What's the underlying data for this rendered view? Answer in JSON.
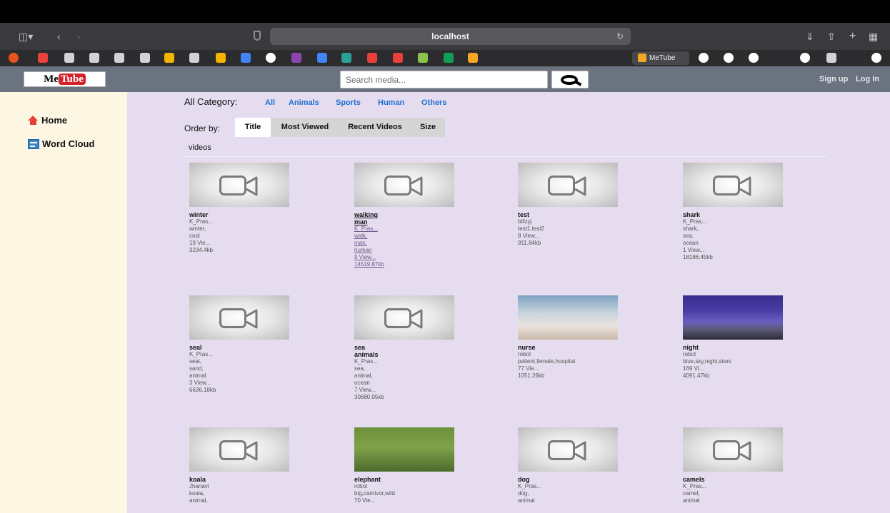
{
  "browser": {
    "url": "localhost",
    "active_tab_label": "MeTube"
  },
  "header": {
    "logo_prefix": "Me",
    "logo_highlight": "Tube",
    "search_placeholder": "Search media...",
    "signup_label": "Sign up",
    "login_label": "Log In"
  },
  "sidebar": {
    "items": [
      {
        "label": "Home",
        "icon": "home-icon"
      },
      {
        "label": "Word Cloud",
        "icon": "word-cloud-icon"
      }
    ]
  },
  "filters": {
    "category_label": "All Category:",
    "categories": [
      "All",
      "Animals",
      "Sports",
      "Human",
      "Others"
    ],
    "order_label": "Order by:",
    "order_options": [
      "Title",
      "Most Viewed",
      "Recent Videos",
      "Size"
    ],
    "selected_order": "Title"
  },
  "videos_label": "videos",
  "videos": [
    {
      "title": "winter",
      "lines": [
        "K_Pras...",
        "winter,",
        "cool",
        "19 Vie...",
        "3234.4kb"
      ],
      "thumb": "placeholder"
    },
    {
      "title": "walking man",
      "lines": [
        "K_Pras...",
        "walk,",
        "man,",
        "human",
        "9 View...",
        "14519.87kb"
      ],
      "thumb": "placeholder"
    },
    {
      "title": "test",
      "lines": [
        "billzyj",
        "test1,test2",
        "8 View...",
        "911.84kb"
      ],
      "thumb": "placeholder"
    },
    {
      "title": "shark",
      "lines": [
        "K_Pras...",
        "shark,",
        "sea,",
        "ocean",
        "1 View...",
        "18186.45kb"
      ],
      "thumb": "placeholder"
    },
    {
      "title": "seal",
      "lines": [
        "K_Pras...",
        "seal,",
        "sand,",
        "animal",
        "3 View...",
        "6636.18kb"
      ],
      "thumb": "placeholder"
    },
    {
      "title": "sea animals",
      "lines": [
        "K_Pras...",
        "sea,",
        "animal,",
        "ocean",
        "7 View...",
        "30680.05kb"
      ],
      "thumb": "placeholder"
    },
    {
      "title": "nurse",
      "lines": [
        "robot",
        "patient,female,hospital",
        "77 Vie...",
        "1051.26kb"
      ],
      "thumb": "nurse"
    },
    {
      "title": "night",
      "lines": [
        "robot",
        "blue,sky,night,stars",
        "169 Vi...",
        "4091.47kb"
      ],
      "thumb": "night"
    },
    {
      "title": "koala",
      "lines": [
        "Jhanavi",
        "koala,",
        "animal,"
      ],
      "thumb": "placeholder"
    },
    {
      "title": "elephant",
      "lines": [
        "robot",
        "big,carnivor,wild",
        "70 Vie..."
      ],
      "thumb": "elephant"
    },
    {
      "title": "dog",
      "lines": [
        "K_Pras...",
        "dog,",
        "animal"
      ],
      "thumb": "placeholder"
    },
    {
      "title": "camels",
      "lines": [
        "K_Pras...",
        "camel,",
        "animal"
      ],
      "thumb": "placeholder"
    }
  ]
}
